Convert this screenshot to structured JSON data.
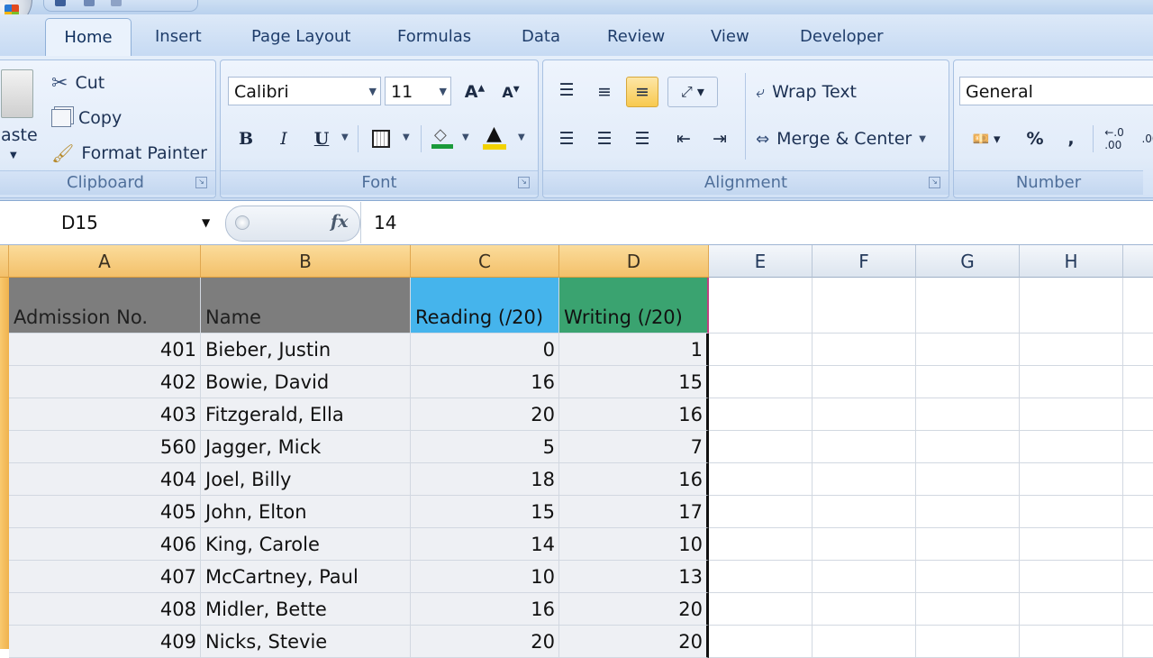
{
  "ribbon_tabs": [
    "Home",
    "Insert",
    "Page Layout",
    "Formulas",
    "Data",
    "Review",
    "View",
    "Developer"
  ],
  "clipboard": {
    "paste_label": "aste",
    "cut_label": "Cut",
    "copy_label": "Copy",
    "format_painter_label": "Format Painter",
    "group_label": "Clipboard"
  },
  "font": {
    "name": "Calibri",
    "size": "11",
    "group_label": "Font",
    "bold": "B",
    "italic": "I",
    "underline": "U"
  },
  "alignment": {
    "wrap_text_label": "Wrap Text",
    "merge_center_label": "Merge & Center",
    "group_label": "Alignment"
  },
  "number": {
    "format": "General",
    "percent": "%",
    "comma": ",",
    "group_label": "Number"
  },
  "formula_bar": {
    "name_box": "D15",
    "fx": "fx",
    "value": "14"
  },
  "columns": [
    "A",
    "B",
    "C",
    "D",
    "E",
    "F",
    "G",
    "H"
  ],
  "table": {
    "headers": [
      "Admission No.",
      "Name",
      "Reading (/20)",
      "Writing (/20)"
    ],
    "rows": [
      [
        "401",
        "Bieber, Justin",
        "0",
        "1"
      ],
      [
        "402",
        "Bowie, David",
        "16",
        "15"
      ],
      [
        "403",
        "Fitzgerald, Ella",
        "20",
        "16"
      ],
      [
        "560",
        "Jagger, Mick",
        "5",
        "7"
      ],
      [
        "404",
        "Joel, Billy",
        "18",
        "16"
      ],
      [
        "405",
        "John, Elton",
        "15",
        "17"
      ],
      [
        "406",
        "King, Carole",
        "14",
        "10"
      ],
      [
        "407",
        "McCartney, Paul",
        "10",
        "13"
      ],
      [
        "408",
        "Midler, Bette",
        "16",
        "20"
      ],
      [
        "409",
        "Nicks, Stevie",
        "20",
        "20"
      ]
    ]
  },
  "colors": {
    "header_gray": "#7d7d7d",
    "header_blue": "#45b4ec",
    "header_green": "#3aa370",
    "selected_column": "#f3c06a"
  }
}
